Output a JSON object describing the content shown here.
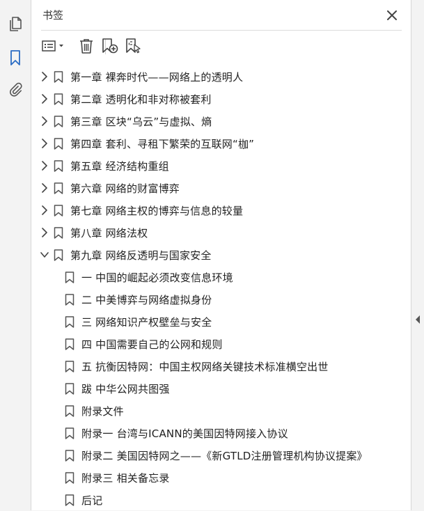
{
  "panel": {
    "title": "书签"
  },
  "colors": {
    "accent": "#2b6cc4",
    "icon_gray": "#555555"
  },
  "left_rail": {
    "items": [
      {
        "icon": "page-thumbnails-icon",
        "active": false
      },
      {
        "icon": "bookmark-icon",
        "active": true
      },
      {
        "icon": "paperclip-icon",
        "active": false
      }
    ]
  },
  "toolbar": {
    "buttons": [
      "options-menu-icon",
      "delete-icon",
      "new-bookmark-icon",
      "bookmark-from-structure-icon"
    ]
  },
  "bookmarks": [
    {
      "label": "第一章  裸奔时代——网络上的透明人",
      "level": 0,
      "expand": "collapsed"
    },
    {
      "label": "第二章  透明化和非对称被套利",
      "level": 0,
      "expand": "collapsed"
    },
    {
      "label": "第三章  区块“乌云”与虚拟、熵",
      "level": 0,
      "expand": "collapsed"
    },
    {
      "label": "第四章  套利、寻租下繁荣的互联网“枷”",
      "level": 0,
      "expand": "collapsed"
    },
    {
      "label": "第五章  经济结构重组",
      "level": 0,
      "expand": "collapsed"
    },
    {
      "label": "第六章  网络的财富博弈",
      "level": 0,
      "expand": "collapsed"
    },
    {
      "label": "第七章  网络主权的博弈与信息的较量",
      "level": 0,
      "expand": "collapsed"
    },
    {
      "label": "第八章  网络法权",
      "level": 0,
      "expand": "collapsed"
    },
    {
      "label": "第九章  网络反透明与国家安全",
      "level": 0,
      "expand": "expanded"
    },
    {
      "label": "一  中国的崛起必须改变信息环境",
      "level": 1,
      "expand": "none"
    },
    {
      "label": "二  中美博弈与网络虚拟身份",
      "level": 1,
      "expand": "none"
    },
    {
      "label": "三  网络知识产权壁垒与安全",
      "level": 1,
      "expand": "none"
    },
    {
      "label": "四  中国需要自己的公网和规则",
      "level": 1,
      "expand": "none"
    },
    {
      "label": "五  抗衡因特网：中国主权网络关键技术标准横空出世",
      "level": 1,
      "expand": "none"
    },
    {
      "label": "跋  中华公网共图强",
      "level": 1,
      "expand": "none"
    },
    {
      "label": "附录文件",
      "level": 1,
      "expand": "none"
    },
    {
      "label": "附录一  台湾与ICANN的美国因特网接入协议",
      "level": 1,
      "expand": "none"
    },
    {
      "label": "附录二  美国因特网之——《新GTLD注册管理机构协议提案》",
      "level": 1,
      "expand": "none"
    },
    {
      "label": "附录三  相关备忘录",
      "level": 1,
      "expand": "none"
    },
    {
      "label": "后记",
      "level": 1,
      "expand": "none"
    }
  ]
}
